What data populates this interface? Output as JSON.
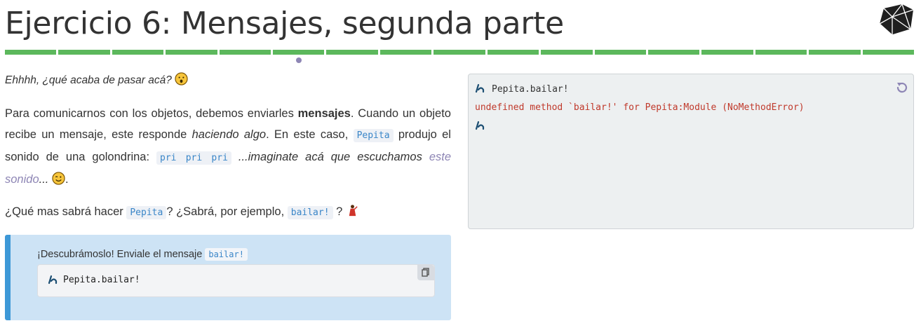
{
  "header": {
    "title": "Ejercicio 6: Mensajes, segunda parte",
    "logo_icon": "ruby-gem-icon",
    "progress": {
      "total_steps": 17,
      "current_step": 6
    }
  },
  "content": {
    "intro": "Ehhhh, ¿qué acaba de pasar acá?",
    "p2_a": "Para comunicarnos con los objetos, debemos enviarles",
    "p2_bold": "mensajes",
    "p2_b": ". Cuando un objeto recibe un mensaje, este responde",
    "p2_italic": "haciendo algo",
    "p2_c": ". En este caso,",
    "p2_code": "Pepita",
    "p2_d": "produjo el sonido de una golondrina:",
    "p2_code2": "pri pri pri",
    "p2_italic2": "...imaginate acá que escuchamos",
    "p2_link": "este sonido",
    "p2_e": "...",
    "p2_end": ".",
    "p3_a": "¿Qué mas sabrá hacer",
    "p3_code": "Pepita",
    "p3_b": "? ¿Sabrá, por ejemplo,",
    "p3_code2": "bailar!",
    "p3_c": "?"
  },
  "hint": {
    "text": "¡Descubrámoslo! Enviale el mensaje",
    "code": "bailar!",
    "command": "Pepita.bailar!",
    "copy_icon": "copy-icon"
  },
  "console": {
    "command": "Pepita.bailar!",
    "error": "undefined method `bailar!' for Pepita:Module (NoMethodError)",
    "reset_icon": "reset-icon"
  },
  "colors": {
    "progress": "#5cb85c",
    "accent": "#3d98d7",
    "hint_bg": "#cde3f5",
    "error": "#c0392b",
    "prompt": "#1d4f73"
  }
}
